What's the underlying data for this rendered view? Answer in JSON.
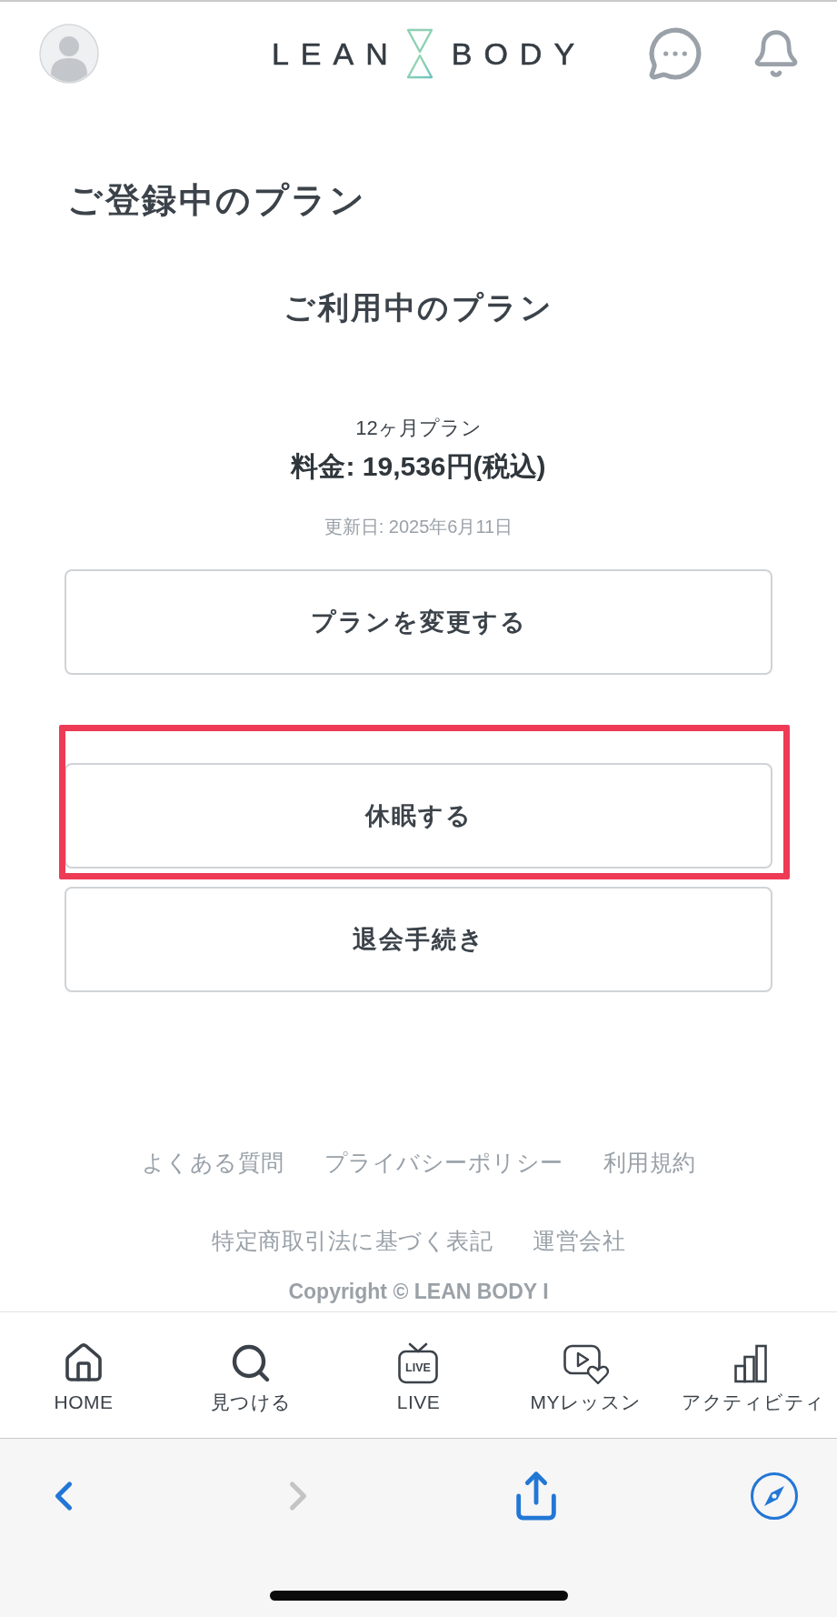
{
  "header": {
    "logo": {
      "left": "LEAN",
      "right": "BODY"
    }
  },
  "page_title": "ご登録中のプラン",
  "plan": {
    "heading": "ご利用中のプラン",
    "name": "12ヶ月プラン",
    "price": "料金: 19,536円(税込)",
    "renewal": "更新日: 2025年6月11日"
  },
  "change_plan_button": {
    "label": "プランを変更する",
    "highlighted": false
  },
  "account_actions": [
    {
      "label": "休眠する",
      "highlighted": true
    },
    {
      "label": "退会手続き",
      "highlighted": false
    }
  ],
  "footer": {
    "link_rows": [
      [
        "よくある質問",
        "プライバシーポリシー",
        "利用規約"
      ],
      [
        "特定商取引法に基づく表記",
        "運営会社"
      ]
    ],
    "copyright": "Copyright © LEAN BODY I"
  },
  "bottom_nav": [
    {
      "kind": "home",
      "label": "HOME"
    },
    {
      "kind": "search",
      "label": "見つける"
    },
    {
      "kind": "live",
      "label": "LIVE",
      "icon_text": "LIVE"
    },
    {
      "kind": "lessons",
      "label": "MYレッスン"
    },
    {
      "kind": "activity",
      "label": "アクティビティ"
    }
  ],
  "browser_toolbar": [
    {
      "kind": "back",
      "disabled": false
    },
    {
      "kind": "forward",
      "disabled": true
    },
    {
      "kind": "share",
      "disabled": false
    },
    {
      "kind": "compass",
      "disabled": false
    }
  ]
}
